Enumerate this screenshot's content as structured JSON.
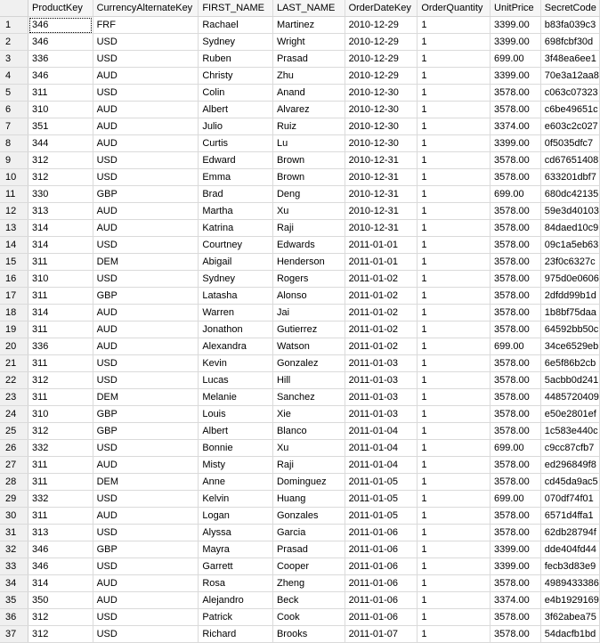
{
  "grid": {
    "columns": [
      "ProductKey",
      "CurrencyAlternateKey",
      "FIRST_NAME",
      "LAST_NAME",
      "OrderDateKey",
      "OrderQuantity",
      "UnitPrice",
      "SecretCode"
    ],
    "rows": [
      [
        "346",
        "FRF",
        "Rachael",
        "Martinez",
        "2010-12-29",
        "1",
        "3399.00",
        "b83fa039c3"
      ],
      [
        "346",
        "USD",
        "Sydney",
        "Wright",
        "2010-12-29",
        "1",
        "3399.00",
        "698fcbf30d"
      ],
      [
        "336",
        "USD",
        "Ruben",
        "Prasad",
        "2010-12-29",
        "1",
        "699.00",
        "3f48ea6ee1"
      ],
      [
        "346",
        "AUD",
        "Christy",
        "Zhu",
        "2010-12-29",
        "1",
        "3399.00",
        "70e3a12aa8"
      ],
      [
        "311",
        "USD",
        "Colin",
        "Anand",
        "2010-12-30",
        "1",
        "3578.00",
        "c063c07323"
      ],
      [
        "310",
        "AUD",
        "Albert",
        "Alvarez",
        "2010-12-30",
        "1",
        "3578.00",
        "c6be49651c"
      ],
      [
        "351",
        "AUD",
        "Julio",
        "Ruiz",
        "2010-12-30",
        "1",
        "3374.00",
        "e603c2c027"
      ],
      [
        "344",
        "AUD",
        "Curtis",
        "Lu",
        "2010-12-30",
        "1",
        "3399.00",
        "0f5035dfc7"
      ],
      [
        "312",
        "USD",
        "Edward",
        "Brown",
        "2010-12-31",
        "1",
        "3578.00",
        "cd67651408"
      ],
      [
        "312",
        "USD",
        "Emma",
        "Brown",
        "2010-12-31",
        "1",
        "3578.00",
        "633201dbf7"
      ],
      [
        "330",
        "GBP",
        "Brad",
        "Deng",
        "2010-12-31",
        "1",
        "699.00",
        "680dc42135"
      ],
      [
        "313",
        "AUD",
        "Martha",
        "Xu",
        "2010-12-31",
        "1",
        "3578.00",
        "59e3d40103"
      ],
      [
        "314",
        "AUD",
        "Katrina",
        "Raji",
        "2010-12-31",
        "1",
        "3578.00",
        "84daed10c9"
      ],
      [
        "314",
        "USD",
        "Courtney",
        "Edwards",
        "2011-01-01",
        "1",
        "3578.00",
        "09c1a5eb63"
      ],
      [
        "311",
        "DEM",
        "Abigail",
        "Henderson",
        "2011-01-01",
        "1",
        "3578.00",
        "23f0c6327c"
      ],
      [
        "310",
        "USD",
        "Sydney",
        "Rogers",
        "2011-01-02",
        "1",
        "3578.00",
        "975d0e0606"
      ],
      [
        "311",
        "GBP",
        "Latasha",
        "Alonso",
        "2011-01-02",
        "1",
        "3578.00",
        "2dfdd99b1d"
      ],
      [
        "314",
        "AUD",
        "Warren",
        "Jai",
        "2011-01-02",
        "1",
        "3578.00",
        "1b8bf75daa"
      ],
      [
        "311",
        "AUD",
        "Jonathon",
        "Gutierrez",
        "2011-01-02",
        "1",
        "3578.00",
        "64592bb50c"
      ],
      [
        "336",
        "AUD",
        "Alexandra",
        "Watson",
        "2011-01-02",
        "1",
        "699.00",
        "34ce6529eb"
      ],
      [
        "311",
        "USD",
        "Kevin",
        "Gonzalez",
        "2011-01-03",
        "1",
        "3578.00",
        "6e5f86b2cb"
      ],
      [
        "312",
        "USD",
        "Lucas",
        "Hill",
        "2011-01-03",
        "1",
        "3578.00",
        "5acbb0d241"
      ],
      [
        "311",
        "DEM",
        "Melanie",
        "Sanchez",
        "2011-01-03",
        "1",
        "3578.00",
        "4485720409"
      ],
      [
        "310",
        "GBP",
        "Louis",
        "Xie",
        "2011-01-03",
        "1",
        "3578.00",
        "e50e2801ef"
      ],
      [
        "312",
        "GBP",
        "Albert",
        "Blanco",
        "2011-01-04",
        "1",
        "3578.00",
        "1c583e440c"
      ],
      [
        "332",
        "USD",
        "Bonnie",
        "Xu",
        "2011-01-04",
        "1",
        "699.00",
        "c9cc87cfb7"
      ],
      [
        "311",
        "AUD",
        "Misty",
        "Raji",
        "2011-01-04",
        "1",
        "3578.00",
        "ed296849f8"
      ],
      [
        "311",
        "DEM",
        "Anne",
        "Dominguez",
        "2011-01-05",
        "1",
        "3578.00",
        "cd45da9ac5"
      ],
      [
        "332",
        "USD",
        "Kelvin",
        "Huang",
        "2011-01-05",
        "1",
        "699.00",
        "070df74f01"
      ],
      [
        "311",
        "AUD",
        "Logan",
        "Gonzales",
        "2011-01-05",
        "1",
        "3578.00",
        "6571d4ffa1"
      ],
      [
        "313",
        "USD",
        "Alyssa",
        "Garcia",
        "2011-01-06",
        "1",
        "3578.00",
        "62db28794f"
      ],
      [
        "346",
        "GBP",
        "Mayra",
        "Prasad",
        "2011-01-06",
        "1",
        "3399.00",
        "dde404fd44"
      ],
      [
        "346",
        "USD",
        "Garrett",
        "Cooper",
        "2011-01-06",
        "1",
        "3399.00",
        "fecb3d83e9"
      ],
      [
        "314",
        "AUD",
        "Rosa",
        "Zheng",
        "2011-01-06",
        "1",
        "3578.00",
        "4989433386"
      ],
      [
        "350",
        "AUD",
        "Alejandro",
        "Beck",
        "2011-01-06",
        "1",
        "3374.00",
        "e4b1929169"
      ],
      [
        "312",
        "USD",
        "Patrick",
        "Cook",
        "2011-01-06",
        "1",
        "3578.00",
        "3f62abea75"
      ],
      [
        "312",
        "USD",
        "Richard",
        "Brooks",
        "2011-01-07",
        "1",
        "3578.00",
        "54dacfb1bd"
      ]
    ],
    "row_numbers": [
      "1",
      "2",
      "3",
      "4",
      "5",
      "6",
      "7",
      "8",
      "9",
      "10",
      "11",
      "12",
      "13",
      "14",
      "15",
      "16",
      "17",
      "18",
      "19",
      "20",
      "21",
      "22",
      "23",
      "24",
      "25",
      "26",
      "27",
      "28",
      "29",
      "30",
      "31",
      "32",
      "33",
      "34",
      "35",
      "36",
      "37"
    ]
  }
}
